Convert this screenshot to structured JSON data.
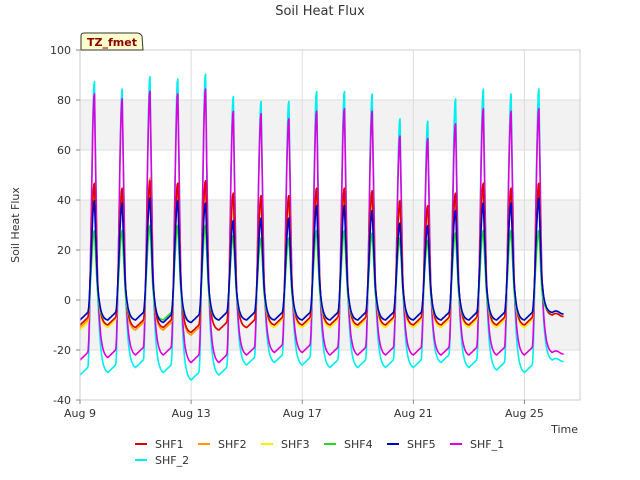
{
  "chart_data": {
    "type": "line",
    "title": "Soil Heat Flux",
    "xlabel": "Time",
    "ylabel": "Soil Heat Flux",
    "site_label": "TZ_fmet",
    "x_range_days": [
      9,
      27
    ],
    "ylim": [
      -40,
      100
    ],
    "y_ticks": [
      -40,
      -20,
      0,
      20,
      40,
      60,
      80,
      100
    ],
    "x_ticks": [
      {
        "label": "Aug 9",
        "day": 9
      },
      {
        "label": "Aug 13",
        "day": 13
      },
      {
        "label": "Aug 17",
        "day": 17
      },
      {
        "label": "Aug 21",
        "day": 21
      },
      {
        "label": "Aug 25",
        "day": 25
      }
    ],
    "grid": true,
    "background_bands": true,
    "legend_position": "bottom",
    "days": [
      9,
      10,
      11,
      12,
      13,
      14,
      15,
      16,
      17,
      18,
      19,
      20,
      21,
      22,
      23,
      24,
      25,
      26
    ],
    "series": [
      {
        "name": "SHF1",
        "color": "#dd0000",
        "daily_peak": [
          47,
          45,
          48,
          47,
          48,
          43,
          42,
          42,
          45,
          45,
          44,
          40,
          38,
          43,
          47,
          45,
          47,
          0
        ],
        "daily_min": [
          -10,
          -10,
          -11,
          -11,
          -13,
          -12,
          -11,
          -10,
          -10,
          -10,
          -10,
          -10,
          -10,
          -10,
          -10,
          -10,
          -10,
          -6
        ]
      },
      {
        "name": "SHF2",
        "color": "#ff9900",
        "daily_peak": [
          47,
          45,
          49,
          47,
          48,
          43,
          42,
          42,
          45,
          45,
          44,
          40,
          38,
          43,
          47,
          45,
          47,
          0
        ],
        "daily_min": [
          -11,
          -10,
          -12,
          -12,
          -14,
          -12,
          -11,
          -10,
          -10,
          -10,
          -10,
          -10,
          -10,
          -10,
          -10,
          -10,
          -10,
          -6
        ]
      },
      {
        "name": "SHF3",
        "color": "#ffee00",
        "daily_peak": [
          46,
          44,
          47,
          46,
          47,
          42,
          41,
          41,
          44,
          44,
          43,
          40,
          37,
          42,
          46,
          44,
          46,
          0
        ],
        "daily_min": [
          -12,
          -11,
          -12,
          -12,
          -13,
          -12,
          -11,
          -11,
          -11,
          -11,
          -11,
          -11,
          -11,
          -11,
          -11,
          -11,
          -11,
          -6
        ]
      },
      {
        "name": "SHF4",
        "color": "#22dd22",
        "daily_peak": [
          28,
          28,
          30,
          30,
          30,
          26,
          25,
          25,
          28,
          28,
          27,
          25,
          24,
          27,
          28,
          28,
          28,
          0
        ],
        "daily_min": [
          -8,
          -8,
          -8,
          -8,
          -9,
          -8,
          -8,
          -8,
          -8,
          -8,
          -8,
          -8,
          -8,
          -8,
          -8,
          -8,
          -8,
          -5
        ]
      },
      {
        "name": "SHF5",
        "color": "#0000cc",
        "daily_peak": [
          40,
          39,
          41,
          40,
          39,
          32,
          33,
          33,
          38,
          38,
          36,
          31,
          30,
          36,
          39,
          39,
          41,
          0
        ],
        "daily_min": [
          -8,
          -8,
          -8,
          -9,
          -9,
          -8,
          -8,
          -8,
          -8,
          -8,
          -8,
          -8,
          -8,
          -8,
          -8,
          -8,
          -8,
          -5
        ]
      },
      {
        "name": "SHF_1",
        "color": "#dd00dd",
        "daily_peak": [
          83,
          81,
          84,
          83,
          85,
          76,
          75,
          73,
          76,
          77,
          76,
          66,
          65,
          71,
          77,
          76,
          77,
          0
        ],
        "daily_min": [
          -24,
          -23,
          -22,
          -22,
          -25,
          -25,
          -22,
          -21,
          -21,
          -22,
          -22,
          -22,
          -22,
          -22,
          -22,
          -22,
          -22,
          -21
        ]
      },
      {
        "name": "SHF_2",
        "color": "#00eeee",
        "daily_peak": [
          88,
          85,
          90,
          89,
          91,
          82,
          80,
          80,
          84,
          84,
          83,
          73,
          72,
          81,
          85,
          83,
          85,
          0
        ],
        "daily_min": [
          -30,
          -29,
          -27,
          -29,
          -32,
          -30,
          -26,
          -25,
          -26,
          -27,
          -27,
          -27,
          -27,
          -25,
          -27,
          -28,
          -29,
          -24
        ]
      }
    ]
  }
}
